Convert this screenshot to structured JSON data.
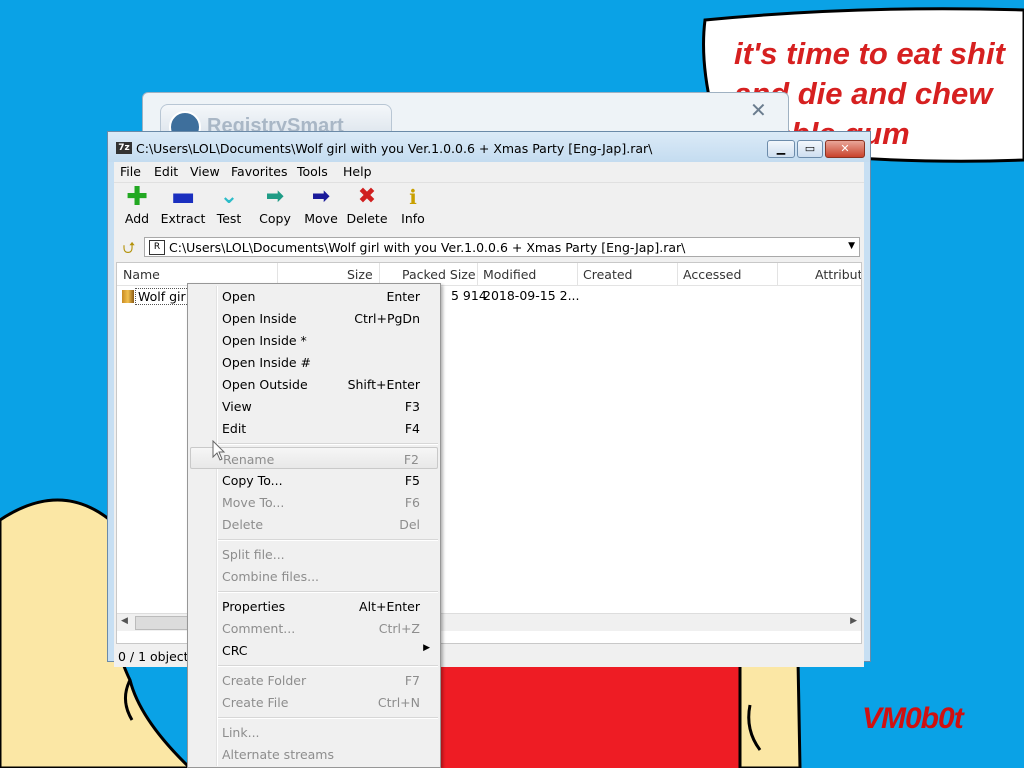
{
  "wallpaper": {
    "bubble_text": "it's time to eat shit\nand die and chew\nbubble gum",
    "signature": "VM0b0t",
    "colors": {
      "sky": "#0aa2e6",
      "red": "#ee1c24",
      "skin": "#fbe7a5",
      "text_red": "#d62020"
    }
  },
  "background_window": {
    "title_logo": "RegistrySmart"
  },
  "window": {
    "title": "C:\\Users\\LOL\\Documents\\Wolf girl with you Ver.1.0.0.6 + Xmas Party [Eng-Jap].rar\\",
    "icon": "7z-icon"
  },
  "menu": [
    "File",
    "Edit",
    "View",
    "Favorites",
    "Tools",
    "Help"
  ],
  "toolbar": [
    {
      "label": "Add",
      "icon": "plus-icon",
      "color": "#22a822"
    },
    {
      "label": "Extract",
      "icon": "minus-icon",
      "color": "#1a2fbf"
    },
    {
      "label": "Test",
      "icon": "check-icon",
      "color": "#2cbcc8"
    },
    {
      "label": "Copy",
      "icon": "copy-arrow-icon",
      "color": "#1f9c86"
    },
    {
      "label": "Move",
      "icon": "move-arrow-icon",
      "color": "#1a1a9a"
    },
    {
      "label": "Delete",
      "icon": "delete-x-icon",
      "color": "#d01f1f"
    },
    {
      "label": "Info",
      "icon": "info-icon",
      "color": "#c9a000"
    }
  ],
  "address": {
    "path": "C:\\Users\\LOL\\Documents\\Wolf girl with you Ver.1.0.0.6 + Xmas Party [Eng-Jap].rar\\"
  },
  "columns": [
    "Name",
    "Size",
    "Packed Size",
    "Modified",
    "Created",
    "Accessed",
    "Attributes"
  ],
  "files": [
    {
      "name": "Wolf gir",
      "size": "",
      "packed": "5 914",
      "modified": "2018-09-15 2...",
      "created": "",
      "accessed": ""
    }
  ],
  "status": "0 / 1 object(",
  "context_menu": [
    {
      "label": "Open",
      "shortcut": "Enter",
      "disabled": false
    },
    {
      "label": "Open Inside",
      "shortcut": "Ctrl+PgDn",
      "disabled": false
    },
    {
      "label": "Open Inside *",
      "shortcut": "",
      "disabled": false
    },
    {
      "label": "Open Inside #",
      "shortcut": "",
      "disabled": false
    },
    {
      "label": "Open Outside",
      "shortcut": "Shift+Enter",
      "disabled": false
    },
    {
      "label": "View",
      "shortcut": "F3",
      "disabled": false
    },
    {
      "label": "Edit",
      "shortcut": "F4",
      "disabled": false
    },
    {
      "label": "Rename",
      "shortcut": "F2",
      "disabled": true,
      "highlighted": true
    },
    {
      "label": "Copy To...",
      "shortcut": "F5",
      "disabled": false
    },
    {
      "label": "Move To...",
      "shortcut": "F6",
      "disabled": true
    },
    {
      "label": "Delete",
      "shortcut": "Del",
      "disabled": true
    },
    {
      "label": "Split file...",
      "shortcut": "",
      "disabled": true
    },
    {
      "label": "Combine files...",
      "shortcut": "",
      "disabled": true
    },
    {
      "label": "Properties",
      "shortcut": "Alt+Enter",
      "disabled": false
    },
    {
      "label": "Comment...",
      "shortcut": "Ctrl+Z",
      "disabled": true
    },
    {
      "label": "CRC",
      "shortcut": "",
      "disabled": false,
      "submenu": true
    },
    {
      "label": "Create Folder",
      "shortcut": "F7",
      "disabled": true
    },
    {
      "label": "Create File",
      "shortcut": "Ctrl+N",
      "disabled": true
    },
    {
      "label": "Link...",
      "shortcut": "",
      "disabled": true
    },
    {
      "label": "Alternate streams",
      "shortcut": "",
      "disabled": true
    }
  ]
}
